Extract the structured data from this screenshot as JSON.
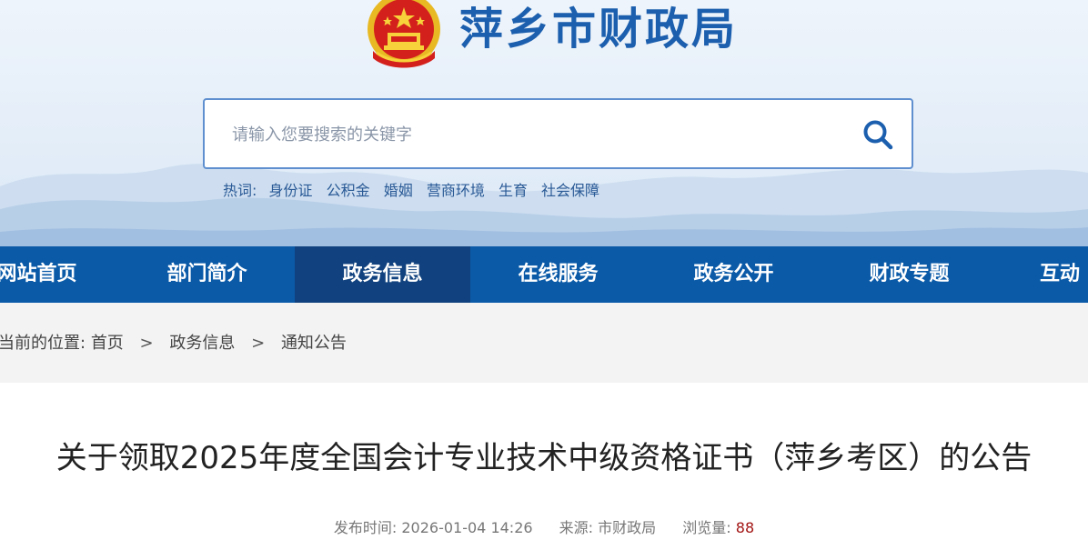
{
  "site": {
    "title": "萍乡市财政局",
    "emblem_icon": "national-emblem-icon",
    "colors": {
      "brand_blue": "#1c5fae",
      "nav_bg": "#0a5aa8",
      "nav_active": "#11427f",
      "views_red": "#a31515"
    }
  },
  "search": {
    "placeholder": "请输入您要搜索的关键字",
    "button_icon": "search-icon"
  },
  "hotwords": {
    "label": "热词:",
    "items": [
      "身份证",
      "公积金",
      "婚姻",
      "营商环境",
      "生育",
      "社会保障"
    ]
  },
  "nav": {
    "items": [
      {
        "label": "网站首页"
      },
      {
        "label": "部门简介"
      },
      {
        "label": "政务信息",
        "active": true
      },
      {
        "label": "在线服务"
      },
      {
        "label": "政务公开"
      },
      {
        "label": "财政专题"
      },
      {
        "label": "互动"
      }
    ]
  },
  "breadcrumb": {
    "label": "当前的位置:",
    "items": [
      "首页",
      "政务信息",
      "通知公告"
    ],
    "separator": ">"
  },
  "article": {
    "title": "关于领取2025年度全国会计专业技术中级资格证书（萍乡考区）的公告",
    "publish_time_label": "发布时间:",
    "publish_time": "2026-01-04 14:26",
    "source_label": "来源:",
    "source": "市财政局",
    "views_label": "浏览量:",
    "views": "88"
  }
}
